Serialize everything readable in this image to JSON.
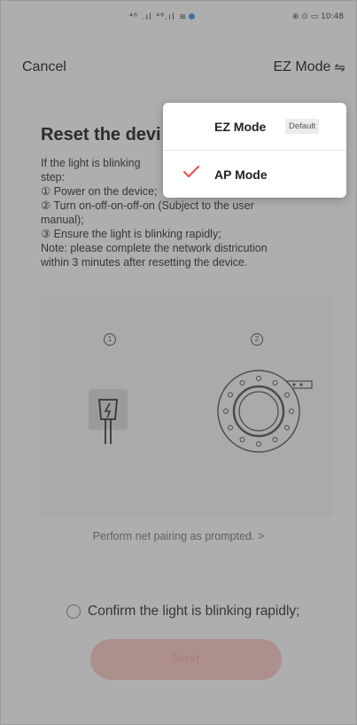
{
  "status_bar": {
    "signal_text": "⁴⁶ .ıl ⁴⁶.ıl ≋",
    "right_text": "⊕ ⊙ ▭ 10:48"
  },
  "nav": {
    "cancel_label": "Cancel",
    "mode_label": "EZ Mode",
    "swap_glyph": "⇋"
  },
  "content": {
    "title": "Reset the devi",
    "lines": [
      "If the light is blinking",
      "step:",
      "① Power on the device;",
      "② Turn on-off-on-off-on (Subject to the user",
      "manual);",
      "③ Ensure the light is blinking rapidly;",
      "Note: please complete the network districution",
      "within 3 minutes after resetting the device."
    ]
  },
  "illustration": {
    "step1_num": "1",
    "step2_num": "2"
  },
  "pairing_link": "Perform net pairing as prompted. >",
  "confirm_label": "Confirm the light is blinking rapidly;",
  "next_label": "Next",
  "dropdown": {
    "items": [
      {
        "label": "EZ Mode",
        "badge": "Default",
        "selected": false
      },
      {
        "label": "AP Mode",
        "selected": true
      }
    ]
  },
  "colors": {
    "accent": "#e8564b",
    "overlay": "#3c3c3c"
  }
}
